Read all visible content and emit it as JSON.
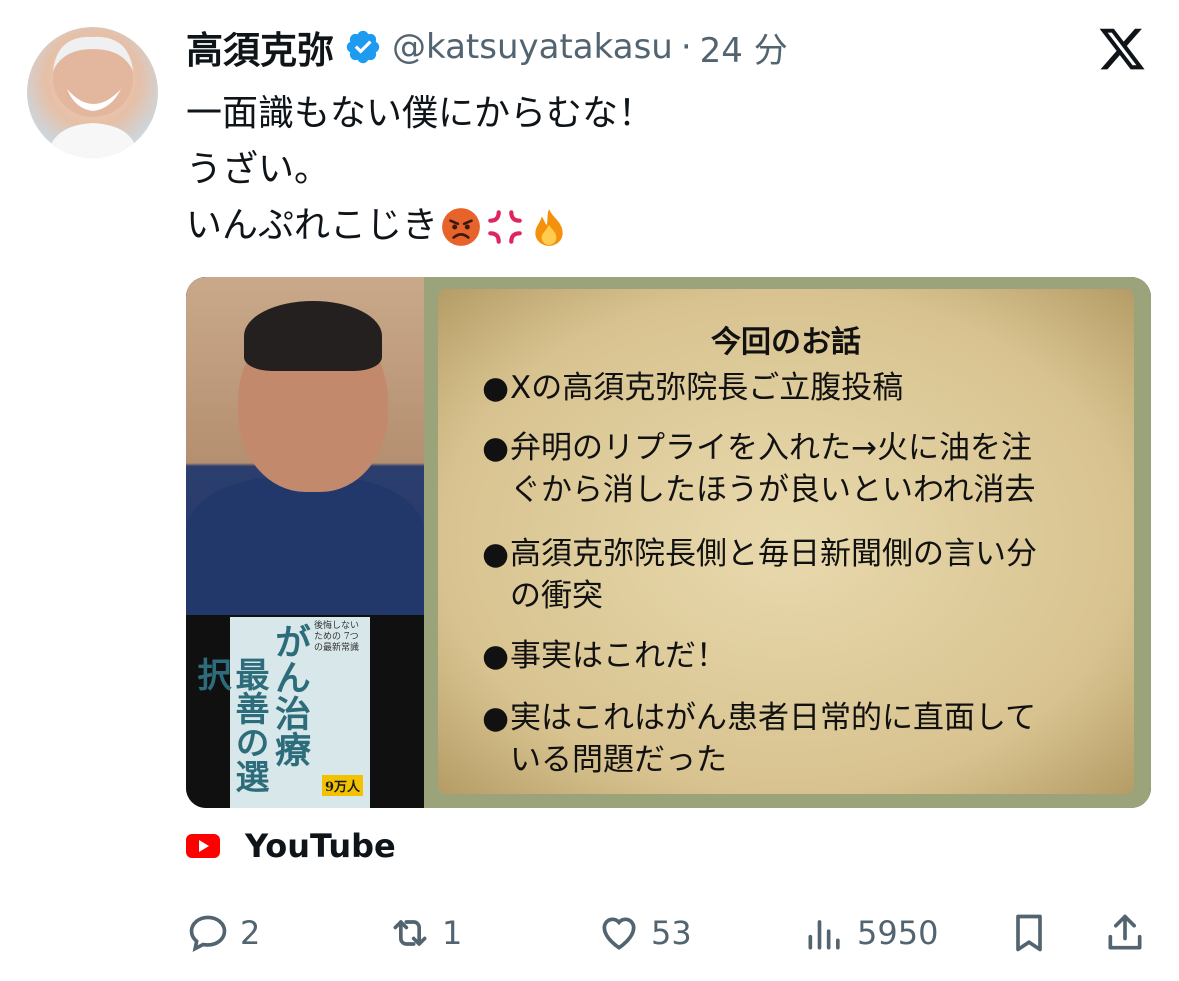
{
  "post": {
    "author_name": "高須克弥",
    "author_handle": "@katsuyatakasu",
    "separator": "·",
    "time": "24 分",
    "lines": [
      "一面識もない僕にからむな！",
      "うざい。",
      "いんぷれこじき"
    ],
    "emojis": [
      "angry-face-emoji",
      "anger-symbol-emoji",
      "fire-emoji"
    ]
  },
  "card": {
    "slide_title": "今回のお話",
    "bullets": [
      [
        "Xの高須克弥院長ご立腹投稿"
      ],
      [
        "弁明のリプライを入れた→火に油を注",
        "ぐから消したほうが良いといわれ消去"
      ],
      [
        "高須克弥院長側と毎日新聞側の言い分",
        "の衝突"
      ],
      [
        "事実はこれだ！"
      ],
      [
        "実はこれはがん患者日常的に直面して",
        "いる問題だった"
      ]
    ],
    "book_title_1": "最善の選択",
    "book_title_2": "がん治療",
    "book_sub": "後悔しない ための 7つの最新常識",
    "book_badge": "9万人",
    "source_label": "YouTube"
  },
  "actions": {
    "replies": "2",
    "reposts": "1",
    "likes": "53",
    "views": "5950"
  },
  "colors": {
    "text": "#0f1419",
    "muted": "#536471",
    "verified": "#1d9bf0",
    "youtube": "#ff0000"
  }
}
